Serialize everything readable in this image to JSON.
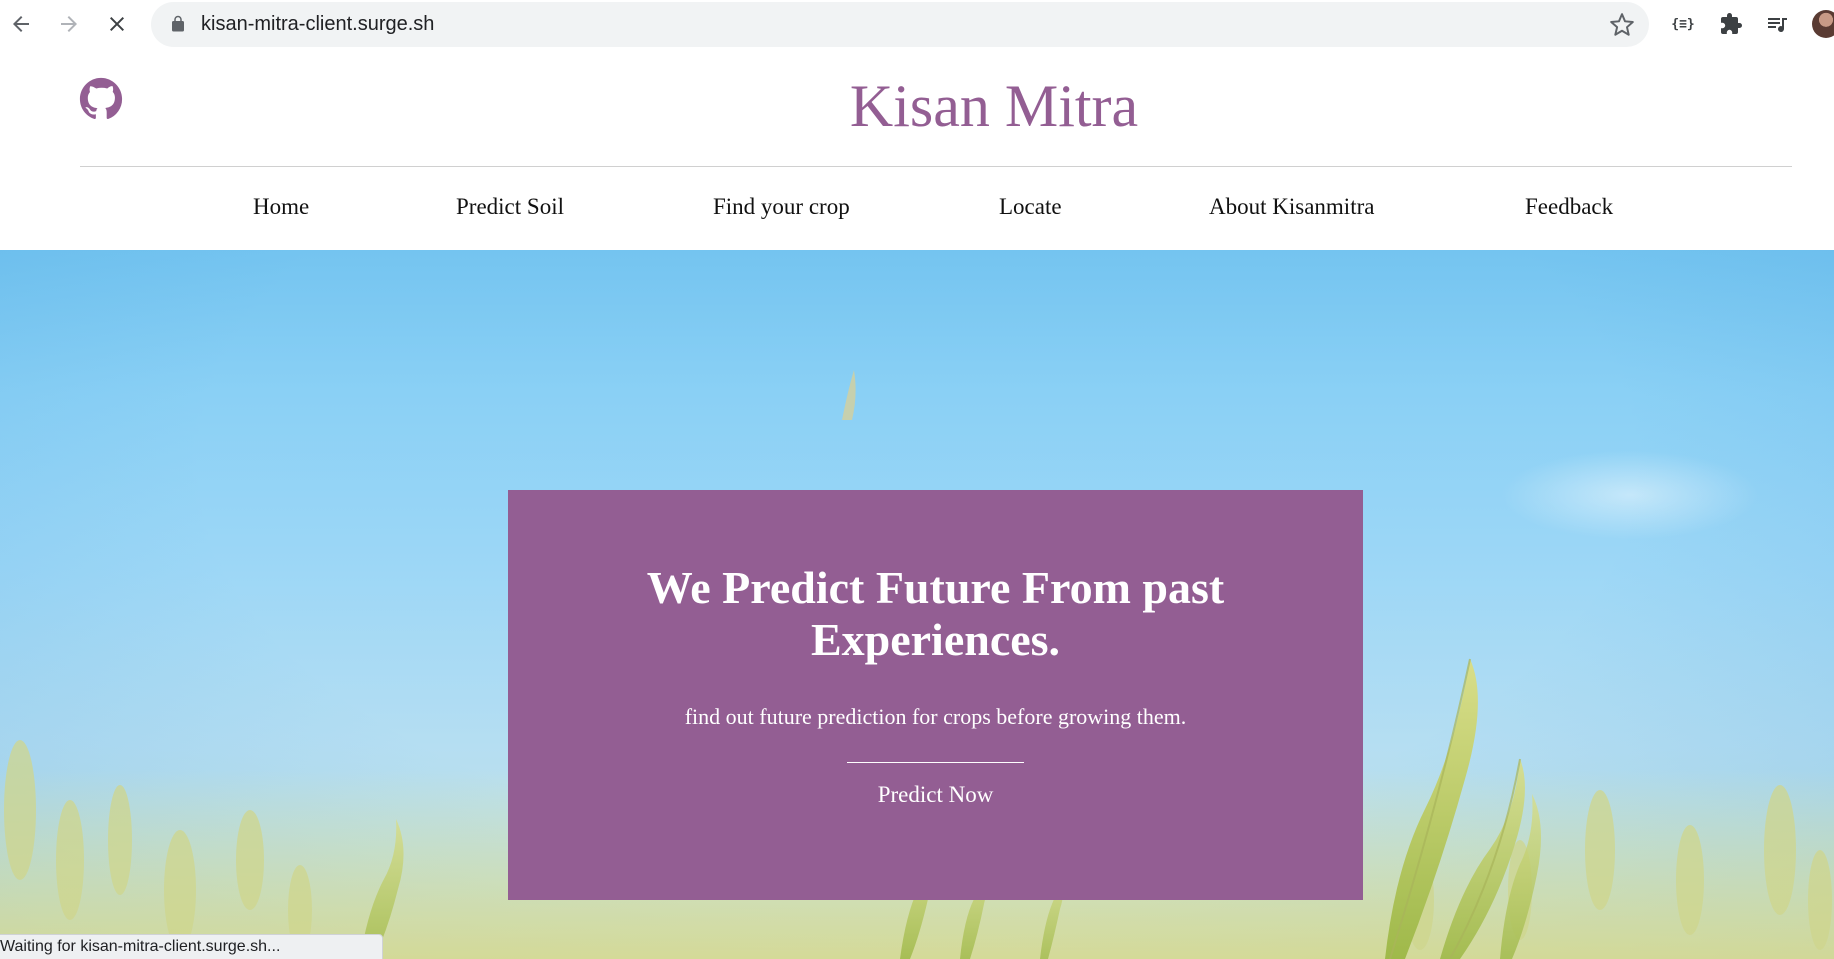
{
  "browser": {
    "url": "kisan-mitra-client.surge.sh",
    "icons": [
      "back-arrow-icon",
      "forward-arrow-icon",
      "stop-loading-icon",
      "lock-icon",
      "bookmark-star-icon",
      "json-viewer-extension-icon",
      "extensions-puzzle-icon",
      "media-queue-icon",
      "profile-avatar"
    ],
    "json_extension_label": "{≡}",
    "status_text": "Waiting for kisan-mitra-client.surge.sh..."
  },
  "header": {
    "brand": "Kisan Mitra",
    "github_icon": "github-icon",
    "brand_color": "#935e93"
  },
  "nav": {
    "items": [
      {
        "label": "Home"
      },
      {
        "label": "Predict Soil"
      },
      {
        "label": "Find your crop"
      },
      {
        "label": "Locate"
      },
      {
        "label": "About Kisanmitra"
      },
      {
        "label": "Feedback"
      }
    ]
  },
  "hero": {
    "background": "sky-and-wheat-field",
    "card_color": "#935e93",
    "title": "We Predict Future From past Experiences.",
    "subtitle": "find out future prediction for crops before growing them.",
    "cta": "Predict Now"
  }
}
